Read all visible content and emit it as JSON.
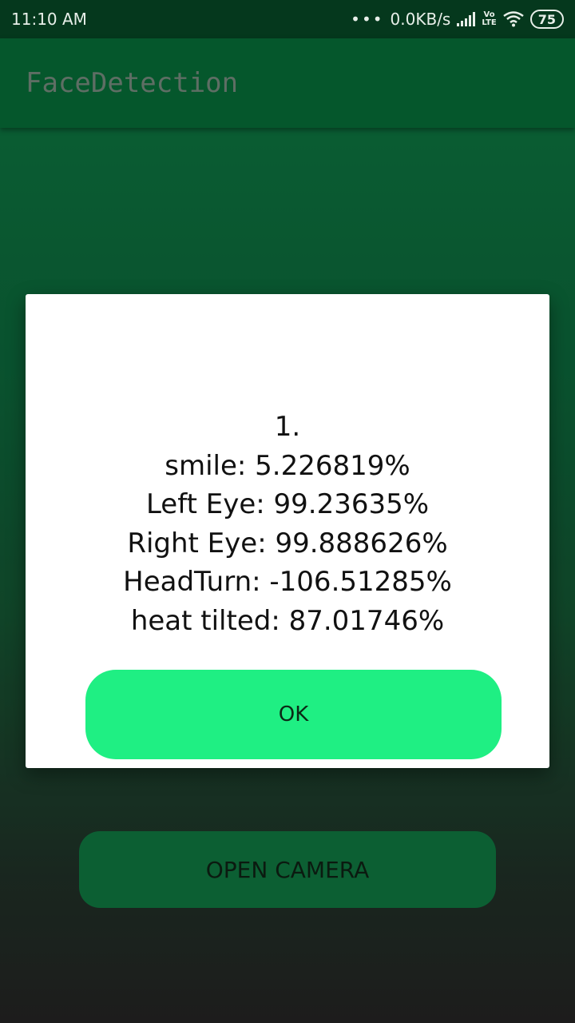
{
  "status_bar": {
    "time": "11:10 AM",
    "net_speed": "0.0KB/s",
    "volte_top": "Vo",
    "volte_bottom": "LTE",
    "battery": "75",
    "icons": [
      "signal-icon",
      "volte-icon",
      "wifi-icon",
      "battery-icon"
    ]
  },
  "app_bar": {
    "title": "FaceDetection"
  },
  "main": {
    "open_camera_label": "OPEN CAMERA"
  },
  "dialog": {
    "lines": [
      "1.",
      "smile: 5.226819%",
      "Left Eye: 99.23635%",
      "Right Eye: 99.888626%",
      "HeadTurn: -106.51285%",
      "heat tilted: 87.01746%"
    ],
    "ok_label": "OK"
  },
  "colors": {
    "status_bar": "#05381d",
    "app_bar": "#05572c",
    "ok_button": "#1fef83",
    "open_camera_button": "#0c5f33"
  }
}
